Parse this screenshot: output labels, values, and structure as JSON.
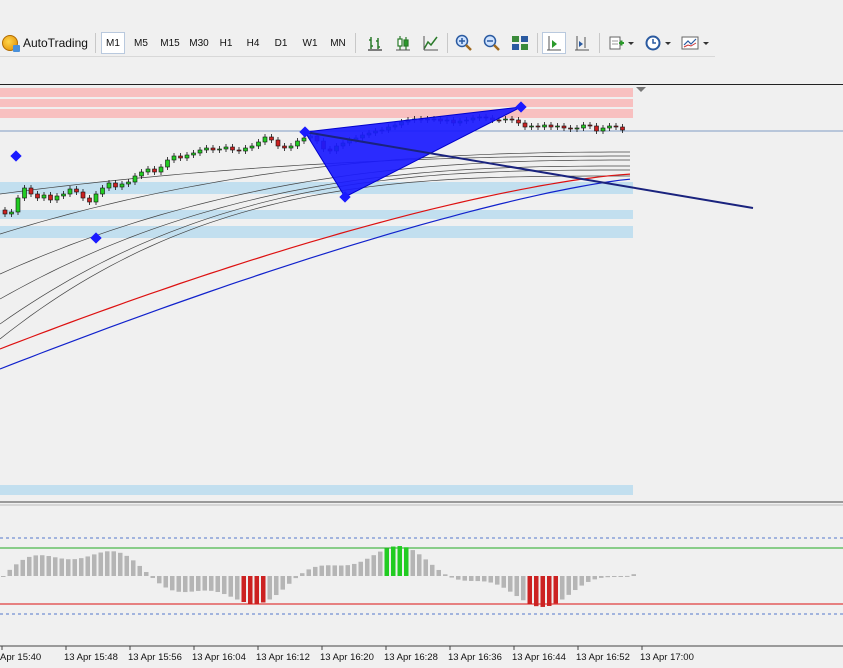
{
  "toolbar": {
    "autotrading_label": "AutoTrading",
    "timeframes": [
      "M1",
      "M5",
      "M15",
      "M30",
      "H1",
      "H4",
      "D1",
      "W1",
      "MN"
    ],
    "active_timeframe": "M1"
  },
  "chart": {
    "time_labels": [
      "Apr 15:40",
      "13 Apr 15:48",
      "13 Apr 15:56",
      "13 Apr 16:04",
      "13 Apr 16:12",
      "13 Apr 16:20",
      "13 Apr 16:28",
      "13 Apr 16:36",
      "13 Apr 16:44",
      "13 Apr 16:52",
      "13 Apr 17:00"
    ],
    "colors": {
      "bull": "#22cc22",
      "bear": "#cc2222",
      "pattern": "#1a1aff",
      "trend_line": "#1a237e",
      "zone_red": "#f8c0c0",
      "zone_blue": "#c2dfef",
      "ma_red": "#dd1111",
      "ma_blue": "#1122cc"
    }
  }
}
